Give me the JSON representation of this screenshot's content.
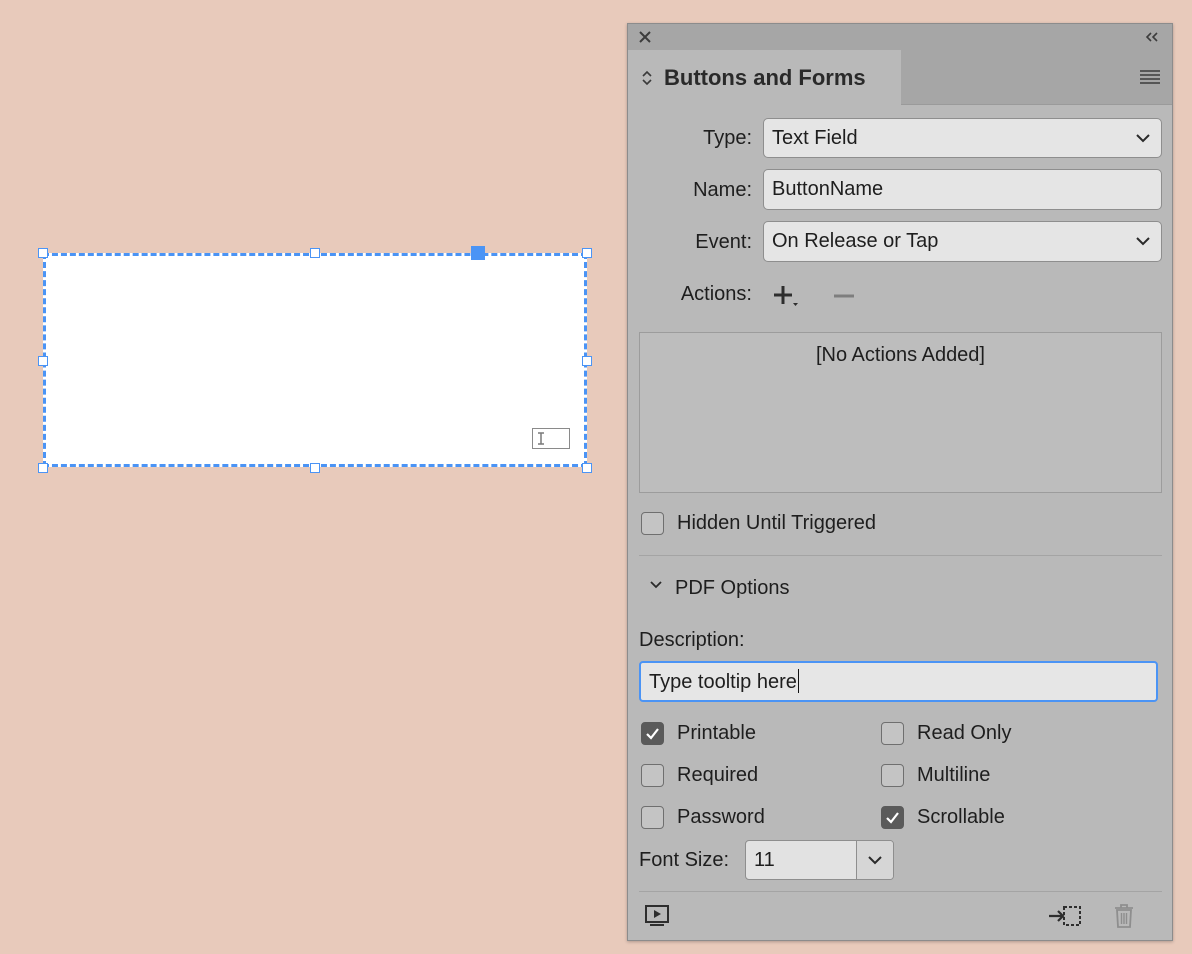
{
  "panel": {
    "title": "Buttons and Forms",
    "type_label": "Type:",
    "type_value": "Text Field",
    "name_label": "Name:",
    "name_value": "ButtonName",
    "event_label": "Event:",
    "event_value": "On Release or Tap",
    "actions_label": "Actions:",
    "actions_empty": "[No Actions Added]",
    "hidden_label": "Hidden Until Triggered",
    "pdf_options_label": "PDF Options",
    "description_label": "Description:",
    "description_value": "Type tooltip here",
    "font_size_label": "Font Size:",
    "font_size_value": "11",
    "options": {
      "printable": {
        "label": "Printable",
        "checked": true
      },
      "read_only": {
        "label": "Read Only",
        "checked": false
      },
      "required": {
        "label": "Required",
        "checked": false
      },
      "multiline": {
        "label": "Multiline",
        "checked": false
      },
      "password": {
        "label": "Password",
        "checked": false
      },
      "scrollable": {
        "label": "Scrollable",
        "checked": true
      }
    }
  },
  "icons": {
    "close": "close-icon",
    "collapse": "double-chevron-icon",
    "menu": "hamburger-menu-icon",
    "add_action": "plus-icon",
    "remove_action": "minus-icon",
    "preview": "preview-icon",
    "convert": "convert-to-object-icon",
    "delete": "trash-icon"
  },
  "colors": {
    "canvas_bg": "#e8cabb",
    "panel_bg": "#b9b9b9",
    "selection": "#4b94f5"
  }
}
